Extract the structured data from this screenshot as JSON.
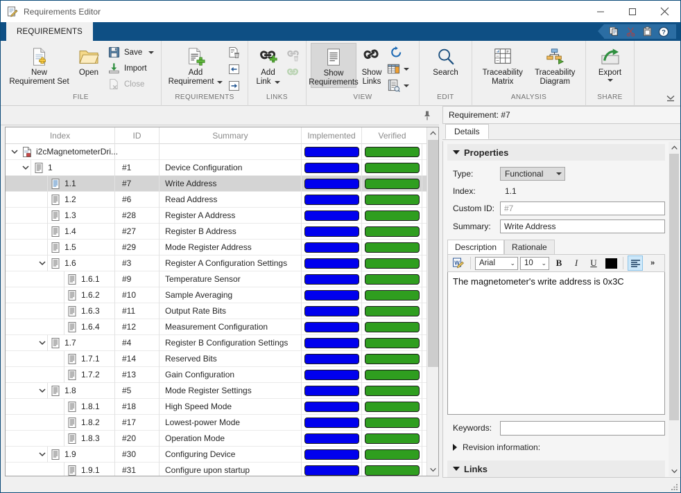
{
  "window": {
    "title": "Requirements Editor",
    "icon": "requirements-editor-icon",
    "minimize": "minimize",
    "maximize": "maximize",
    "close": "close"
  },
  "ribbon": {
    "tab": "REQUIREMENTS",
    "quick_access": [
      "copy-icon",
      "cut-icon",
      "paste-icon",
      "help-icon"
    ],
    "groups": [
      {
        "label": "FILE",
        "big": [
          {
            "name": "new-requirement-set",
            "line1": "New",
            "line2": "Requirement Set",
            "icon": "new-document-icon"
          },
          {
            "name": "open",
            "line1": "Open",
            "line2": "",
            "icon": "folder-open-icon"
          }
        ],
        "small": [
          {
            "name": "save",
            "label": "Save",
            "icon": "save-icon",
            "dropdown": true,
            "disabled": false
          },
          {
            "name": "import",
            "label": "Import",
            "icon": "import-icon",
            "dropdown": false,
            "disabled": false
          },
          {
            "name": "close",
            "label": "Close",
            "icon": "close-file-icon",
            "dropdown": false,
            "disabled": true
          }
        ]
      },
      {
        "label": "REQUIREMENTS",
        "big": [
          {
            "name": "add-requirement",
            "line1": "Add",
            "line2": "Requirement",
            "icon": "add-requirement-icon",
            "dropdown": true
          }
        ],
        "icons": [
          "delete-requirement-icon",
          "promote-icon",
          "demote-icon"
        ]
      },
      {
        "label": "LINKS",
        "big": [
          {
            "name": "add-link",
            "line1": "Add",
            "line2": "Link",
            "icon": "add-link-icon",
            "dropdown": true
          }
        ],
        "icons": [
          "delete-link-icon",
          "link-set-icon"
        ]
      },
      {
        "label": "VIEW",
        "big": [
          {
            "name": "show-requirements",
            "line1": "Show",
            "line2": "Requirements",
            "icon": "show-requirements-icon",
            "active": true
          },
          {
            "name": "show-links",
            "line1": "Show",
            "line2": "Links",
            "icon": "show-links-icon",
            "active": false
          }
        ],
        "icons": [
          "refresh-icon",
          "columns-icon",
          "report-icon"
        ]
      },
      {
        "label": "EDIT",
        "big": [
          {
            "name": "search",
            "line1": "Search",
            "line2": "",
            "icon": "search-icon"
          }
        ]
      },
      {
        "label": "ANALYSIS",
        "big": [
          {
            "name": "traceability-matrix",
            "line1": "Traceability",
            "line2": "Matrix",
            "icon": "traceability-matrix-icon"
          },
          {
            "name": "traceability-diagram",
            "line1": "Traceability",
            "line2": "Diagram",
            "icon": "traceability-diagram-icon"
          }
        ]
      },
      {
        "label": "SHARE",
        "big": [
          {
            "name": "export",
            "line1": "Export",
            "line2": "",
            "icon": "export-icon",
            "dropdown": true
          }
        ]
      }
    ]
  },
  "table": {
    "pin_icon": "pin-icon",
    "columns": [
      "Index",
      "ID",
      "Summary",
      "Implemented",
      "Verified"
    ],
    "colors": {
      "implemented": "#0000ee",
      "verified": "#2f9e1f",
      "selected_row": "#d4d4d4"
    },
    "rows": [
      {
        "depth": 0,
        "index": "i2cMagnetometerDri...",
        "id": "",
        "summary": "",
        "expander": "expanded",
        "icon": "requirement-set-icon",
        "implemented": true,
        "verified": true,
        "selected": false
      },
      {
        "depth": 1,
        "index": "1",
        "id": "#1",
        "summary": "Device Configuration",
        "expander": "expanded",
        "icon": "requirement-icon",
        "implemented": true,
        "verified": true,
        "selected": false
      },
      {
        "depth": 2,
        "index": "1.1",
        "id": "#7",
        "summary": "Write Address",
        "expander": "none",
        "icon": "requirement-icon-selected",
        "implemented": true,
        "verified": true,
        "selected": true
      },
      {
        "depth": 2,
        "index": "1.2",
        "id": "#6",
        "summary": "Read Address",
        "expander": "none",
        "icon": "requirement-icon",
        "implemented": true,
        "verified": true,
        "selected": false
      },
      {
        "depth": 2,
        "index": "1.3",
        "id": "#28",
        "summary": "Register A Address",
        "expander": "none",
        "icon": "requirement-icon",
        "implemented": true,
        "verified": true,
        "selected": false
      },
      {
        "depth": 2,
        "index": "1.4",
        "id": "#27",
        "summary": "Register B Address",
        "expander": "none",
        "icon": "requirement-icon",
        "implemented": true,
        "verified": true,
        "selected": false
      },
      {
        "depth": 2,
        "index": "1.5",
        "id": "#29",
        "summary": "Mode Register Address",
        "expander": "none",
        "icon": "requirement-icon",
        "implemented": true,
        "verified": true,
        "selected": false
      },
      {
        "depth": 2,
        "index": "1.6",
        "id": "#3",
        "summary": "Register A Configuration Settings",
        "expander": "expanded",
        "icon": "requirement-icon",
        "implemented": true,
        "verified": true,
        "selected": false
      },
      {
        "depth": 3,
        "index": "1.6.1",
        "id": "#9",
        "summary": "Temperature Sensor",
        "expander": "none",
        "icon": "requirement-icon",
        "implemented": true,
        "verified": true,
        "selected": false
      },
      {
        "depth": 3,
        "index": "1.6.2",
        "id": "#10",
        "summary": "Sample Averaging",
        "expander": "none",
        "icon": "requirement-icon",
        "implemented": true,
        "verified": true,
        "selected": false
      },
      {
        "depth": 3,
        "index": "1.6.3",
        "id": "#11",
        "summary": "Output Rate Bits",
        "expander": "none",
        "icon": "requirement-icon",
        "implemented": true,
        "verified": true,
        "selected": false
      },
      {
        "depth": 3,
        "index": "1.6.4",
        "id": "#12",
        "summary": "Measurement Configuration",
        "expander": "none",
        "icon": "requirement-icon",
        "implemented": true,
        "verified": true,
        "selected": false
      },
      {
        "depth": 2,
        "index": "1.7",
        "id": "#4",
        "summary": "Register B Configuration Settings",
        "expander": "expanded",
        "icon": "requirement-icon",
        "implemented": true,
        "verified": true,
        "selected": false
      },
      {
        "depth": 3,
        "index": "1.7.1",
        "id": "#14",
        "summary": "Reserved Bits",
        "expander": "none",
        "icon": "requirement-icon",
        "implemented": true,
        "verified": true,
        "selected": false
      },
      {
        "depth": 3,
        "index": "1.7.2",
        "id": "#13",
        "summary": "Gain Configuration",
        "expander": "none",
        "icon": "requirement-icon",
        "implemented": true,
        "verified": true,
        "selected": false
      },
      {
        "depth": 2,
        "index": "1.8",
        "id": "#5",
        "summary": "Mode Register Settings",
        "expander": "expanded",
        "icon": "requirement-icon",
        "implemented": true,
        "verified": true,
        "selected": false
      },
      {
        "depth": 3,
        "index": "1.8.1",
        "id": "#18",
        "summary": "High Speed Mode",
        "expander": "none",
        "icon": "requirement-icon",
        "implemented": true,
        "verified": true,
        "selected": false
      },
      {
        "depth": 3,
        "index": "1.8.2",
        "id": "#17",
        "summary": "Lowest-power Mode",
        "expander": "none",
        "icon": "requirement-icon",
        "implemented": true,
        "verified": true,
        "selected": false
      },
      {
        "depth": 3,
        "index": "1.8.3",
        "id": "#20",
        "summary": "Operation Mode",
        "expander": "none",
        "icon": "requirement-icon",
        "implemented": true,
        "verified": true,
        "selected": false
      },
      {
        "depth": 2,
        "index": "1.9",
        "id": "#30",
        "summary": "Configuring Device",
        "expander": "expanded",
        "icon": "requirement-icon",
        "implemented": true,
        "verified": true,
        "selected": false
      },
      {
        "depth": 3,
        "index": "1.9.1",
        "id": "#31",
        "summary": "Configure upon startup",
        "expander": "none",
        "icon": "requirement-icon",
        "implemented": true,
        "verified": true,
        "selected": false
      }
    ]
  },
  "details": {
    "header": "Requirement: #7",
    "tab": "Details",
    "properties": {
      "title": "Properties",
      "type_label": "Type:",
      "type_value": "Functional",
      "index_label": "Index:",
      "index_value": "1.1",
      "custom_id_label": "Custom ID:",
      "custom_id_placeholder": "#7",
      "custom_id_value": "",
      "summary_label": "Summary:",
      "summary_value": "Write Address"
    },
    "editor": {
      "tabs": [
        "Description",
        "Rationale"
      ],
      "active_tab": "Description",
      "word_icon": "open-in-word-icon",
      "font_family": "Arial",
      "font_size": "10",
      "bold": "B",
      "italic": "I",
      "underline": "U",
      "text_color": "#000000",
      "align_icon": "align-left-icon",
      "overflow": "»",
      "content": "The magnetometer's write address is 0x3C"
    },
    "keywords_label": "Keywords:",
    "keywords_value": "",
    "revision_label": "Revision information:",
    "links_title": "Links"
  }
}
